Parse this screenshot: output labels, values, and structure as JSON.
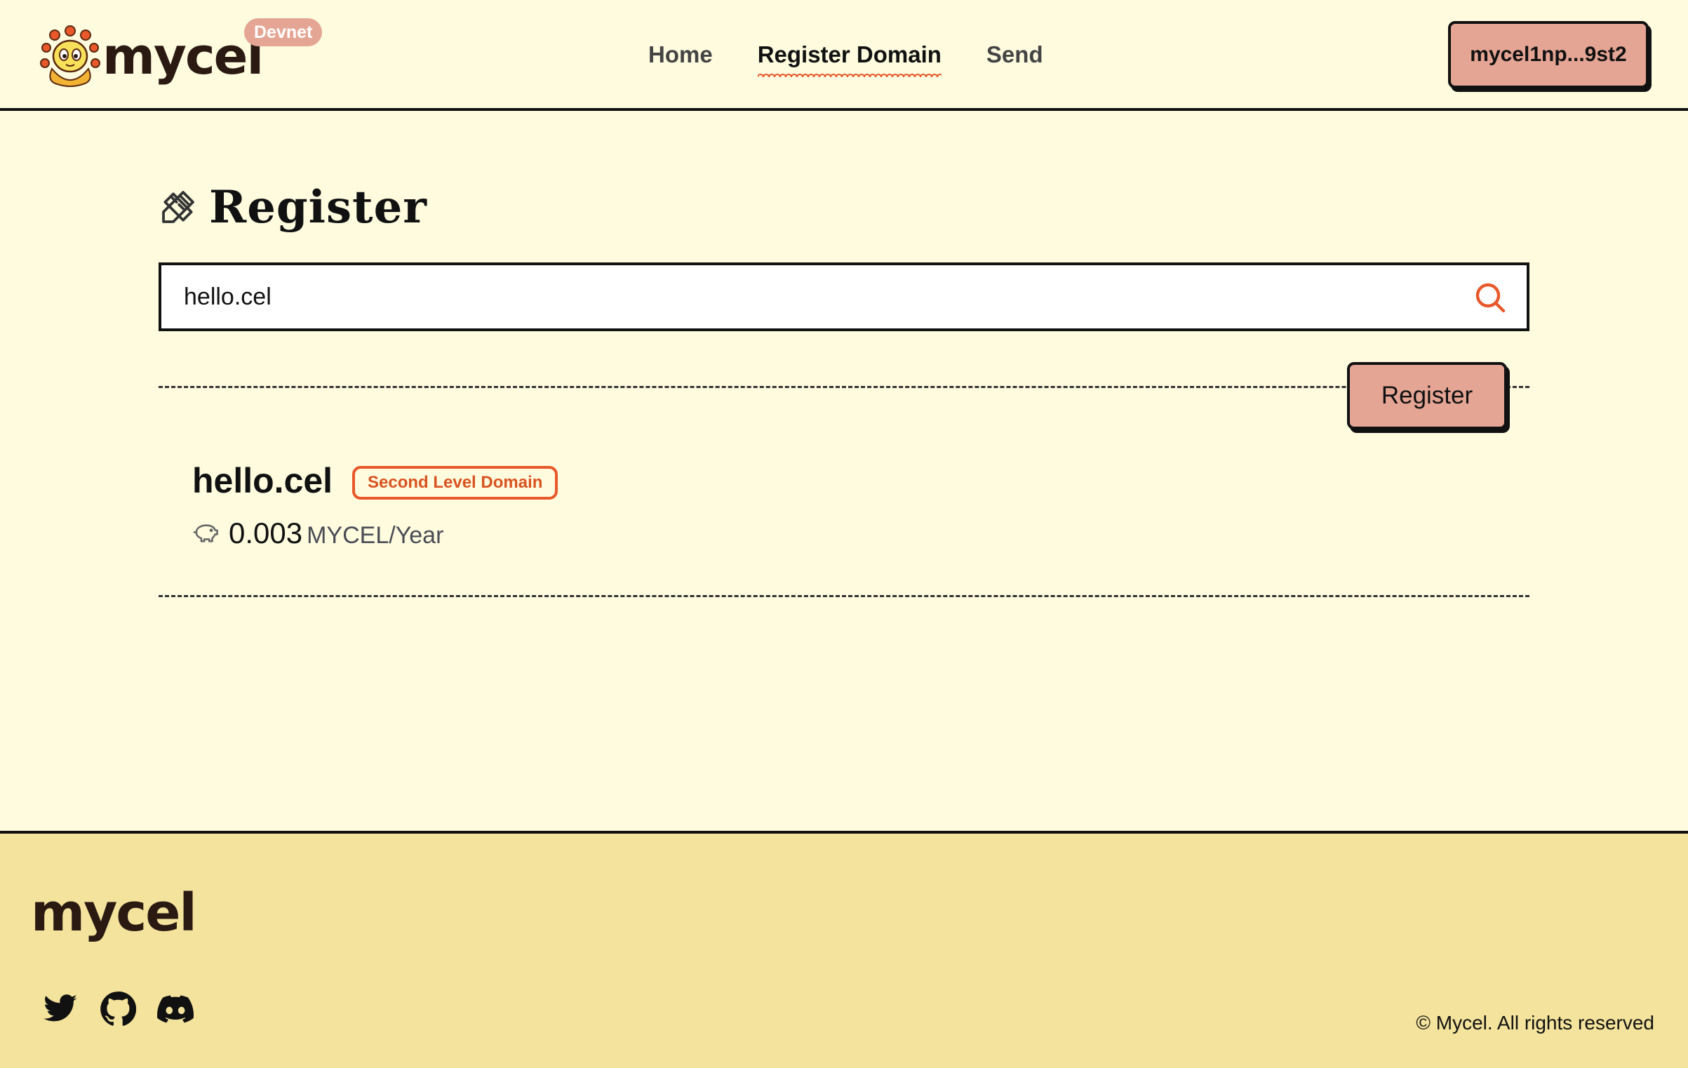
{
  "header": {
    "logo_text": "mycel",
    "network_badge": "Devnet",
    "nav": [
      {
        "label": "Home",
        "active": false
      },
      {
        "label": "Register Domain",
        "active": true
      },
      {
        "label": "Send",
        "active": false
      }
    ],
    "wallet_label": "mycel1np...9st2"
  },
  "main": {
    "title": "Register",
    "title_icon": "pencil-ruler-icon",
    "search": {
      "value": "hello.cel",
      "icon": "search-icon"
    },
    "result": {
      "domain": "hello.cel",
      "badge": "Second Level Domain",
      "price_icon": "piggy-bank-icon",
      "price": "0.003",
      "unit": "MYCEL/Year",
      "register_label": "Register"
    }
  },
  "footer": {
    "logo_text": "mycel",
    "socials": [
      "twitter-icon",
      "github-icon",
      "discord-icon"
    ],
    "copyright": "© Mycel. All rights reserved"
  },
  "colors": {
    "background": "#fefbdf",
    "footer_bg": "#f3e39c",
    "button_bg": "#e5a594",
    "accent": "#e8582a",
    "border": "#111111"
  }
}
